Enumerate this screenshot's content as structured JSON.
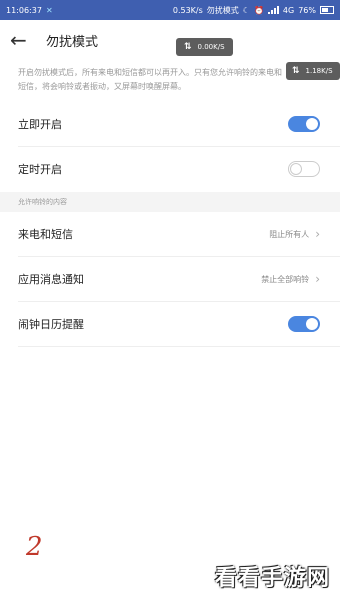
{
  "status_bar": {
    "time": "11:06:37",
    "speed": "0.53K/s",
    "dnd_label": "勿扰模式",
    "network": "4G",
    "battery": "76%"
  },
  "app_bar": {
    "back_icon": "arrow-left-icon",
    "title": "勿扰模式"
  },
  "floating_speed": [
    {
      "speed": "0.00K/S"
    },
    {
      "speed": "1.18K/S"
    }
  ],
  "description": "开启勿扰模式后，所有来电和短信都可以再开入。只有您允许响铃的来电和短信，将会响铃或者振动，又屏幕时唤醒屏幕。",
  "settings": {
    "immediate": {
      "label": "立即开启",
      "enabled": true
    },
    "scheduled": {
      "label": "定时开启",
      "enabled": false
    }
  },
  "section_header": "允许响铃的内容",
  "content": {
    "calls": {
      "label": "来电和短信",
      "value": "阻止所有人"
    },
    "apps": {
      "label": "应用消息通知",
      "value": "禁止全部响铃"
    },
    "alarm": {
      "label": "闹钟日历提醒",
      "enabled": true
    }
  },
  "annotation": "2",
  "watermark": "看看手游网"
}
